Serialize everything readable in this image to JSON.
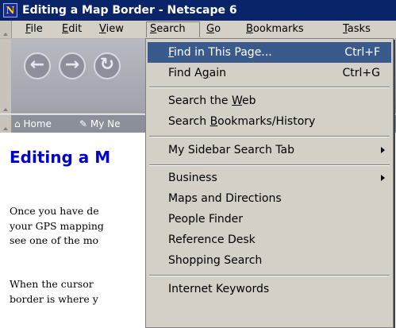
{
  "window": {
    "title": "Editing a Map Border - Netscape 6",
    "icon": "N"
  },
  "menubar": {
    "items": [
      {
        "label": "File",
        "u": "F"
      },
      {
        "label": "Edit",
        "u": "E"
      },
      {
        "label": "View",
        "u": "V"
      },
      {
        "label": "Search",
        "u": "S"
      },
      {
        "label": "Go",
        "u": "G"
      },
      {
        "label": "Bookmarks",
        "u": "B"
      },
      {
        "label": "Tasks",
        "u": "T"
      }
    ]
  },
  "navbar": {
    "back_icon": "back-arrow-icon",
    "forward_icon": "forward-arrow-icon"
  },
  "personal_toolbar": {
    "home_label": "Home",
    "mynetscape_label": "My Ne"
  },
  "content": {
    "title": "Editing a M",
    "para1": [
      "Once you have de",
      "your GPS mapping",
      "see one of the mo"
    ],
    "para2": [
      "When the cursor",
      "border is where y"
    ]
  },
  "search_menu": {
    "items": [
      {
        "label": "Find in This Page...",
        "shortcut": "Ctrl+F",
        "highlighted": true
      },
      {
        "label": "Find Again",
        "shortcut": "Ctrl+G"
      },
      {
        "label": "Search the Web"
      },
      {
        "label": "Search Bookmarks/History"
      },
      {
        "label": "My Sidebar Search Tab",
        "submenu": true
      },
      {
        "label": "Business",
        "submenu": true
      },
      {
        "label": "Maps and Directions"
      },
      {
        "label": "People Finder"
      },
      {
        "label": "Reference Desk"
      },
      {
        "label": "Shopping Search"
      },
      {
        "label": "Internet Keywords"
      }
    ]
  },
  "colors": {
    "titlebar": "#0a246a",
    "highlight": "#3a5a8c",
    "link_title": "#0000cc"
  }
}
